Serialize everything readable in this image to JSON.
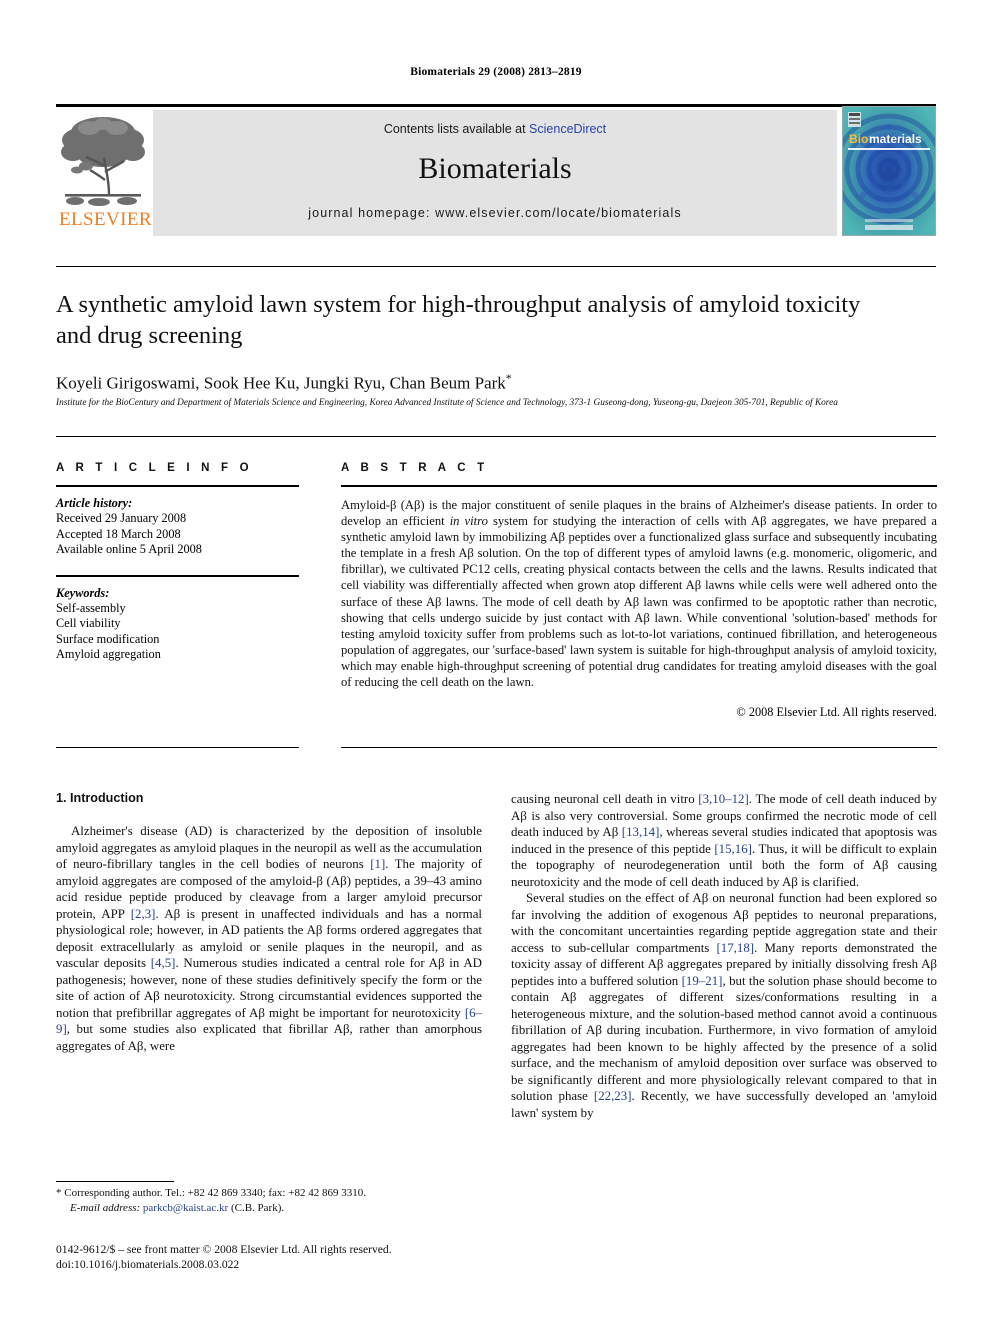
{
  "running_head": "Biomaterials 29 (2008) 2813–2819",
  "masthead": {
    "contents_prefix": "Contents lists available at ",
    "sciencedirect": "ScienceDirect",
    "journal_name": "Biomaterials",
    "homepage": "journal homepage: www.elsevier.com/locate/biomaterials",
    "publisher_wordmark": "ELSEVIER",
    "cover_title_bio": "Bio",
    "cover_title_materials": "materials",
    "accent_orange": "#ef7d22",
    "link_blue": "#2a3fb0",
    "cover_teal": "#49b0b4",
    "cover_blue": "#1b3fa0"
  },
  "article": {
    "title": "A synthetic amyloid lawn system for high-throughput analysis of amyloid toxicity and drug screening",
    "authors": "Koyeli Girigoswami, Sook Hee Ku, Jungki Ryu, Chan Beum Park",
    "corresponding_mark": "*",
    "affiliation": "Institute for the BioCentury and Department of Materials Science and Engineering, Korea Advanced Institute of Science and Technology, 373-1 Guseong-dong, Yuseong-gu, Daejeon 305-701, Republic of Korea"
  },
  "article_info": {
    "label": "A R T I C L E  I N F O",
    "history_title": "Article history:",
    "history": [
      "Received 29 January 2008",
      "Accepted 18 March 2008",
      "Available online 5 April 2008"
    ],
    "keywords_title": "Keywords:",
    "keywords": [
      "Self-assembly",
      "Cell viability",
      "Surface modification",
      "Amyloid aggregation"
    ]
  },
  "abstract": {
    "label": "A B S T R A C T",
    "part1": "Amyloid-β (Aβ) is the major constituent of senile plaques in the brains of Alzheimer's disease patients. In order to develop an efficient ",
    "italic1": "in vitro",
    "part2": " system for studying the interaction of cells with Aβ aggregates, we have prepared a synthetic amyloid lawn by immobilizing Aβ peptides over a functionalized glass surface and subsequently incubating the template in a fresh Aβ solution. On the top of different types of amyloid lawns (e.g. monomeric, oligomeric, and fibrillar), we cultivated PC12 cells, creating physical contacts between the cells and the lawns. Results indicated that cell viability was differentially affected when grown atop different Aβ lawns while cells were well adhered onto the surface of these Aβ lawns. The mode of cell death by Aβ lawn was confirmed to be apoptotic rather than necrotic, showing that cells undergo suicide by just contact with Aβ lawn. While conventional 'solution-based' methods for testing amyloid toxicity suffer from problems such as lot-to-lot variations, continued fibrillation, and heterogeneous population of aggregates, our 'surface-based' lawn system is suitable for high-throughput analysis of amyloid toxicity, which may enable high-throughput screening of potential drug candidates for treating amyloid diseases with the goal of reducing the cell death on the lawn.",
    "copyright": "© 2008 Elsevier Ltd. All rights reserved."
  },
  "introduction": {
    "heading": "1. Introduction",
    "left_p1_a": "Alzheimer's disease (AD) is characterized by the deposition of insoluble amyloid aggregates as amyloid plaques in the neuropil as well as the accumulation of neuro-fibrillary tangles in the cell bodies of neurons ",
    "left_ref1": "[1]",
    "left_p1_b": ". The majority of amyloid aggregates are composed of the amyloid-β (Aβ) peptides, a 39–43 amino acid residue peptide produced by cleavage from a larger amyloid precursor protein, APP ",
    "left_ref2": "[2,3]",
    "left_p1_c": ". Aβ is present in unaffected individuals and has a normal physiological role; however, in AD patients the Aβ forms ordered aggregates that deposit extracellularly as amyloid or senile plaques in the neuropil, and as vascular deposits ",
    "left_ref3": "[4,5]",
    "left_p1_d": ". Numerous studies indicated a central role for Aβ in AD pathogenesis; however, none of these studies definitively specify the form or the site of action of Aβ neurotoxicity. Strong circumstantial evidences supported the notion that prefibrillar aggregates of Aβ might be important for neurotoxicity ",
    "left_ref4": "[6–9]",
    "left_p1_e": ", but some studies also explicated that fibrillar Aβ, rather than amorphous aggregates of Aβ, were",
    "right_p1_a": "causing neuronal cell death ",
    "right_italic1": "in vitro",
    "right_ref1": " [3,10–12]",
    "right_p1_b": ". The mode of cell death induced by Aβ is also very controversial. Some groups confirmed the necrotic mode of cell death induced by Aβ ",
    "right_ref2": "[13,14]",
    "right_p1_c": ", whereas several studies indicated that apoptosis was induced in the presence of this peptide ",
    "right_ref3": "[15,16]",
    "right_p1_d": ". Thus, it will be difficult to explain the topography of neurodegeneration until both the form of Aβ causing neurotoxicity and the mode of cell death induced by Aβ is clarified.",
    "right_p2_a": "Several studies on the effect of Aβ on neuronal function had been explored so far involving the addition of exogenous Aβ peptides to neuronal preparations, with the concomitant uncertainties regarding peptide aggregation state and their access to sub-cellular compartments ",
    "right_ref4": "[17,18]",
    "right_p2_b": ". Many reports demonstrated the toxicity assay of different Aβ aggregates prepared by initially dissolving fresh Aβ peptides into a buffered solution ",
    "right_ref5": "[19–21]",
    "right_p2_c": ", but the solution phase should become to contain Aβ aggregates of different sizes/conformations resulting in a heterogeneous mixture, and the solution-based method cannot avoid a continuous fibrillation of Aβ during incubation. Furthermore, ",
    "right_italic2": "in vivo",
    "right_p2_d": " formation of amyloid aggregates had been known to be highly affected by the presence of a solid surface, and the mechanism of amyloid deposition over surface was observed to be significantly different and more physiologically relevant compared to that in solution phase ",
    "right_ref6": "[22,23]",
    "right_p2_e": ". Recently, we have successfully developed an 'amyloid lawn' system by"
  },
  "footnotes": {
    "corresponding": "* Corresponding author. Tel.: +82 42 869 3340; fax: +82 42 869 3310.",
    "email_label": "E-mail address:",
    "email": "parkcb@kaist.ac.kr",
    "email_attrib": " (C.B. Park).",
    "issn_line": "0142-9612/$ – see front matter © 2008 Elsevier Ltd. All rights reserved.",
    "doi_line": "doi:10.1016/j.biomaterials.2008.03.022"
  }
}
